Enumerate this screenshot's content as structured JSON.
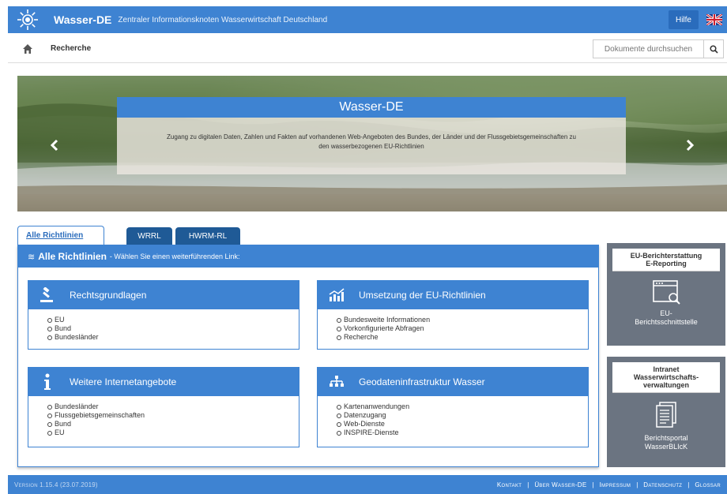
{
  "header": {
    "brand": "Wasser-DE",
    "subtitle": "Zentraler Informationsknoten Wasserwirtschaft Deutschland",
    "help_label": "Hilfe",
    "accent_color": "#3e83d2"
  },
  "nav": {
    "breadcrumb": "Recherche",
    "search_placeholder": "Dokumente durchsuchen"
  },
  "hero": {
    "title": "Wasser-DE",
    "text": "Zugang zu digitalen Daten, Zahlen und Fakten auf vorhandenen Web-Angeboten des Bundes, der Länder und der Flussgebietsgemeinschaften zu den wasserbezogenen EU-Richtlinien"
  },
  "tabs": [
    {
      "label": "Alle Richtlinien",
      "active": true
    },
    {
      "label": "WRRL",
      "active": false
    },
    {
      "label": "HWRM-RL",
      "active": false
    }
  ],
  "panel": {
    "title": "Alle Richtlinien",
    "desc": "- Wählen Sie einen weiterführenden Link:"
  },
  "cards": {
    "rechts": {
      "title": "Rechtsgrundlagen",
      "icon": "gavel-icon",
      "items": [
        "EU",
        "Bund",
        "Bundesländer"
      ]
    },
    "umsetzung": {
      "title": "Umsetzung der EU-Richtlinien",
      "icon": "chart-icon",
      "items": [
        "Bundesweite Informationen",
        "Vorkonfigurierte Abfragen",
        "Recherche"
      ]
    },
    "weitere": {
      "title": "Weitere Internetangebote",
      "icon": "info-icon",
      "items": [
        "Bundesländer",
        "Flussgebietsgemeinschaften",
        "Bund",
        "EU"
      ]
    },
    "geo": {
      "title": "Geodateninfrastruktur Wasser",
      "icon": "sitemap-icon",
      "items": [
        "Kartenanwendungen",
        "Datenzugang",
        "Web-Dienste",
        "INSPIRE-Dienste"
      ]
    }
  },
  "side": {
    "reporting": {
      "head_line1": "EU-Berichterstattung",
      "head_line2": "E-Reporting",
      "text_line1": "EU-",
      "text_line2": "Berichtsschnittstelle"
    },
    "intranet": {
      "head_line1": "Intranet",
      "head_line2": "Wasserwirtschafts-",
      "head_line3": "verwaltungen",
      "text_line1": "Berichtsportal",
      "text_line2": "WasserBLIcK"
    }
  },
  "footer": {
    "version": "Version 1.15.4 (23.07.2019)",
    "links": [
      "Kontakt",
      "Über Wasser-DE",
      "Impressum",
      "Datenschutz",
      "Glossar"
    ]
  }
}
